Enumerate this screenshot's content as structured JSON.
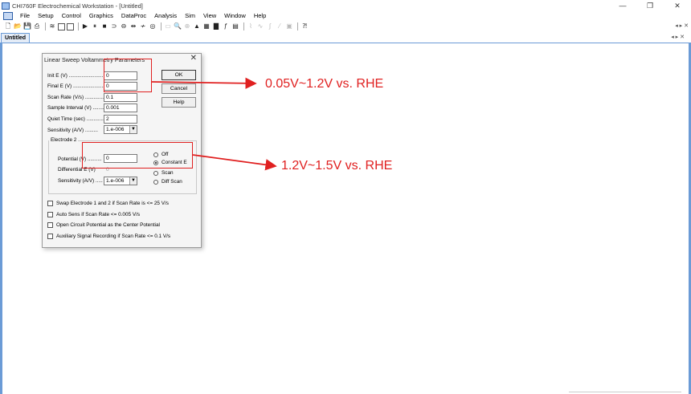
{
  "window": {
    "title": "CHI760F Electrochemical Workstation - [Untitled]",
    "controls": [
      "—",
      "❐",
      "✕"
    ]
  },
  "menu": [
    "File",
    "Setup",
    "Control",
    "Graphics",
    "DataProc",
    "Analysis",
    "Sim",
    "View",
    "Window",
    "Help"
  ],
  "doc_tab": {
    "label": "Untitled"
  },
  "dialog": {
    "title": "Linear Sweep Voltammetry Parameters",
    "close": "✕",
    "init_e_label": "Init E (V) ........................",
    "init_e_value": "0",
    "final_e_label": "Final E (V) .......................",
    "final_e_value": "0",
    "scan_rate_label": "Scan Rate (V/s) ..............",
    "scan_rate_value": "0.1",
    "sample_interval_label": "Sample Interval (V) ........",
    "sample_interval_value": "0.001",
    "quiet_time_label": "Quiet Time (sec) ..............",
    "quiet_time_value": "2",
    "sensitivity_label": "Sensitivity (A/V) .........",
    "sensitivity_value": "1.e-006",
    "ok_label": "OK",
    "cancel_label": "Cancel",
    "help_label": "Help",
    "electrode2": {
      "title": "Electrode 2",
      "potential_label": "Potential (V) ..........",
      "potential_value": "0",
      "diff_e_label": "Differential E (V)",
      "diff_e_value": "0",
      "sensitivity_label": "Sensitivity (A/V) .....",
      "sensitivity_value": "1.e-006",
      "opt_off": "Off",
      "opt_constant": "Constant E",
      "opt_scan": "Scan",
      "opt_diff_scan": "Diff Scan"
    },
    "checks": [
      "Swap Electrode 1 and 2 if Scan Rate is <= 25 V/s",
      "Auto Sens if Scan Rate <= 0.005 V/s",
      "Open Circuit Potential as the Center Potential",
      "Auxiliary Signal Recording if Scan Rate <= 0.1 V/s"
    ]
  },
  "annotations": {
    "top": "0.05V~1.2V  vs. RHE",
    "bottom": "1.2V~1.5V vs. RHE",
    "color": "#e02020"
  }
}
